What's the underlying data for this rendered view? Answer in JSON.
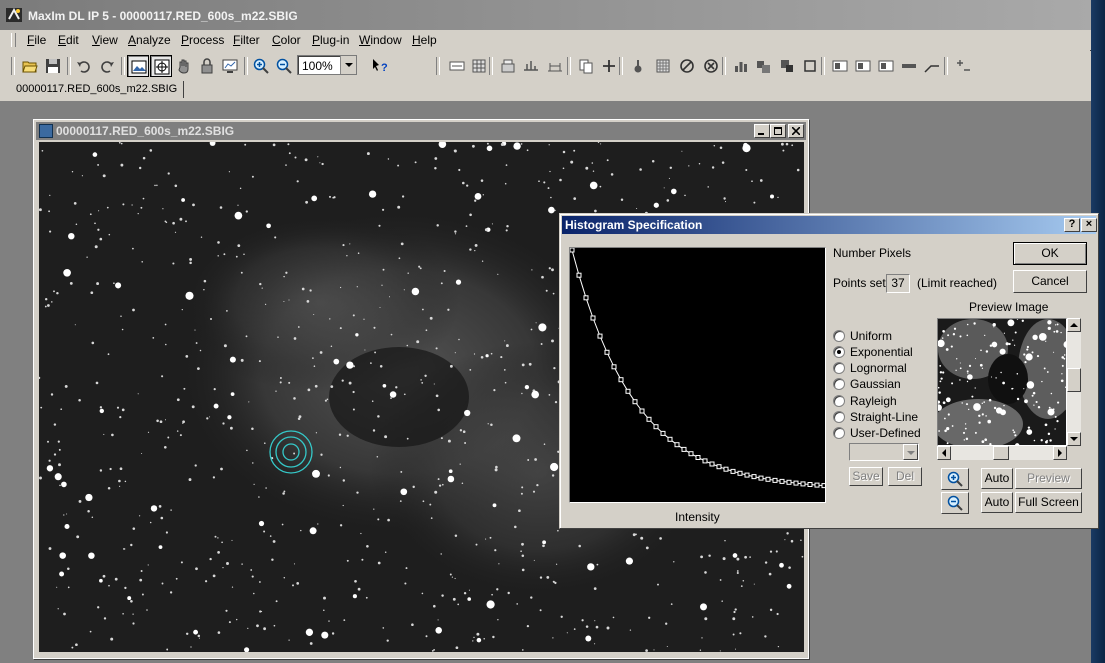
{
  "app": {
    "title": "MaxIm DL IP 5 - 00000117.RED_600s_m22.SBIG"
  },
  "menu": [
    {
      "label": "File",
      "key": "F",
      "rest": "ile"
    },
    {
      "label": "Edit",
      "key": "E",
      "rest": "dit"
    },
    {
      "label": "View",
      "key": "V",
      "rest": "iew"
    },
    {
      "label": "Analyze",
      "key": "A",
      "rest": "nalyze"
    },
    {
      "label": "Process",
      "key": "P",
      "rest": "rocess"
    },
    {
      "label": "Filter",
      "key": "F",
      "rest": "ilter"
    },
    {
      "label": "Color",
      "key": "C",
      "rest": "olor"
    },
    {
      "label": "Plug-in",
      "key": "P",
      "rest": "lug-in"
    },
    {
      "label": "Window",
      "key": "W",
      "rest": "indow"
    },
    {
      "label": "Help",
      "key": "H",
      "rest": "elp"
    }
  ],
  "toolbar": {
    "zoom_value": "100%"
  },
  "document_tab": {
    "label": "00000117.RED_600s_m22.SBIG"
  },
  "image_window": {
    "title": "00000117.RED_600s_m22.SBIG"
  },
  "dialog": {
    "title": "Histogram Specification",
    "help_button": "?",
    "close_button": "×",
    "number_pixels_label": "Number Pixels",
    "points_set_label": "Points set:",
    "points_set_value": "37",
    "limit_text": "(Limit reached)",
    "ok_label": "OK",
    "cancel_label": "Cancel",
    "preview_image_label": "Preview Image",
    "intensity_label": "Intensity",
    "save_label": "Save",
    "del_label": "Del",
    "auto_label_1": "Auto",
    "preview_label": "Preview",
    "auto_label_2": "Auto",
    "full_screen_label": "Full Screen",
    "distributions": [
      {
        "label": "Uniform",
        "selected": false
      },
      {
        "label": "Exponential",
        "selected": true
      },
      {
        "label": "Lognormal",
        "selected": false
      },
      {
        "label": "Gaussian",
        "selected": false
      },
      {
        "label": "Rayleigh",
        "selected": false
      },
      {
        "label": "Straight-Line",
        "selected": false
      },
      {
        "label": "User-Defined",
        "selected": false
      }
    ],
    "curve": {
      "type": "exponential",
      "points": 37,
      "decay": 4.0,
      "color": "#ffffff"
    }
  },
  "colors": {
    "dialog_title_start": "#0a246a",
    "dialog_title_end": "#a6caf0",
    "aperture_ring": "#35c8c8"
  }
}
